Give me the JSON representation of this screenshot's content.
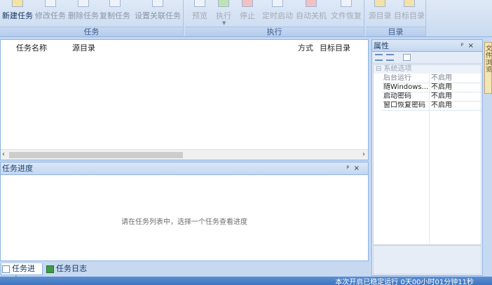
{
  "ribbon": {
    "groups": [
      {
        "title": "任务",
        "buttons": [
          "新建任务",
          "修改任务",
          "删除任务",
          "复制任务",
          "设置关联任务"
        ]
      },
      {
        "title": "执行",
        "buttons": [
          "预览",
          "执行",
          "停止",
          "定时启动",
          "自动关机",
          "文件恢复"
        ]
      },
      {
        "title": "目录",
        "buttons": [
          "源目录",
          "目标目录"
        ]
      }
    ]
  },
  "task_list": {
    "columns": [
      "任务名称",
      "源目录",
      "方式",
      "目标目录"
    ]
  },
  "progress_panel": {
    "title": "任务进度",
    "empty_message": "请在任务列表中，选择一个任务查看进度",
    "pin_icon": "pin-icon",
    "close_icon": "close-icon"
  },
  "bottom_tabs": [
    "任务进度",
    "任务日志"
  ],
  "properties": {
    "title": "属性",
    "category": "系统选项",
    "rows": [
      {
        "key": "后台运行",
        "value": "不启用"
      },
      {
        "key": "随Windows...",
        "value": "不启用"
      },
      {
        "key": "启动密码",
        "value": "不启用"
      },
      {
        "key": "窗口恢复密码",
        "value": "不启用"
      }
    ]
  },
  "side_tab": "文件浏览",
  "status": {
    "text": "本次开启已稳定运行 0天00小时01分钟11秒"
  },
  "colors": {
    "accent": "#3f74bd",
    "ribbon_bg": "#dfe9f7",
    "side_tab": "#f5e4b5"
  }
}
